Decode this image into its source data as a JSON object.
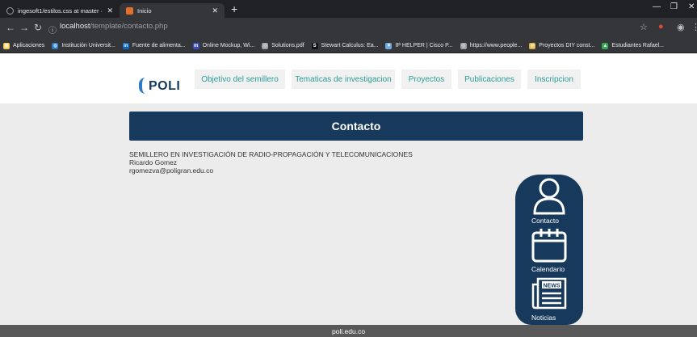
{
  "browser": {
    "tabs": [
      {
        "title": "ingesoft1/estilos.css at master ·",
        "active": false
      },
      {
        "title": "Inicio",
        "active": true
      }
    ],
    "url_host": "localhost",
    "url_path": "/template/contacto.php",
    "bookmarks": [
      {
        "label": "Aplicaciones",
        "icon": "apps-grid-icon",
        "color": "#f2c94c"
      },
      {
        "label": "Institución Universit...",
        "icon": "globe-icon",
        "color": "#2e7bc4"
      },
      {
        "label": "Fuente de alimenta...",
        "icon": "linkedin-icon",
        "color": "#0a66c2"
      },
      {
        "label": "Online Mockup, Wi...",
        "icon": "mockup-icon",
        "color": "#3b4cc0"
      },
      {
        "label": "Solutions.pdf",
        "icon": "web-icon",
        "color": "#9aa0a6"
      },
      {
        "label": "Stewart Calculus: Ea...",
        "icon": "s-icon",
        "color": "#111"
      },
      {
        "label": "IP HELPER | Cisco P...",
        "icon": "cisco-icon",
        "color": "#6fa8dc"
      },
      {
        "label": "https://www.people...",
        "icon": "web-icon",
        "color": "#9aa0a6"
      },
      {
        "label": "Proyectos DIY const...",
        "icon": "diy-icon",
        "color": "#e0b43c"
      },
      {
        "label": "Estudiantes Rafael...",
        "icon": "drive-icon",
        "color": "#34a853"
      }
    ]
  },
  "site": {
    "logo_text": "POLI",
    "nav": [
      "Objetivo del semillero",
      "Tematicas de investigacion",
      "Proyectos",
      "Publicaciones",
      "Inscripcion"
    ],
    "banner": "Contacto",
    "info": {
      "group": "SEMILLERO EN INVESTIGACIÓN DE RADIO-PROPAGACIÓN Y TELECOMUNICACIONES",
      "name": "Ricardo Gomez",
      "email": "rgomezva@poligran.edu.co"
    },
    "quick_links": [
      {
        "label": "Contacto",
        "icon": "user-icon"
      },
      {
        "label": "Calendario",
        "icon": "calendar-icon"
      },
      {
        "label": "Noticias",
        "icon": "newspaper-icon",
        "badge": "NEWS"
      }
    ],
    "footer": "poli.edu.co"
  }
}
